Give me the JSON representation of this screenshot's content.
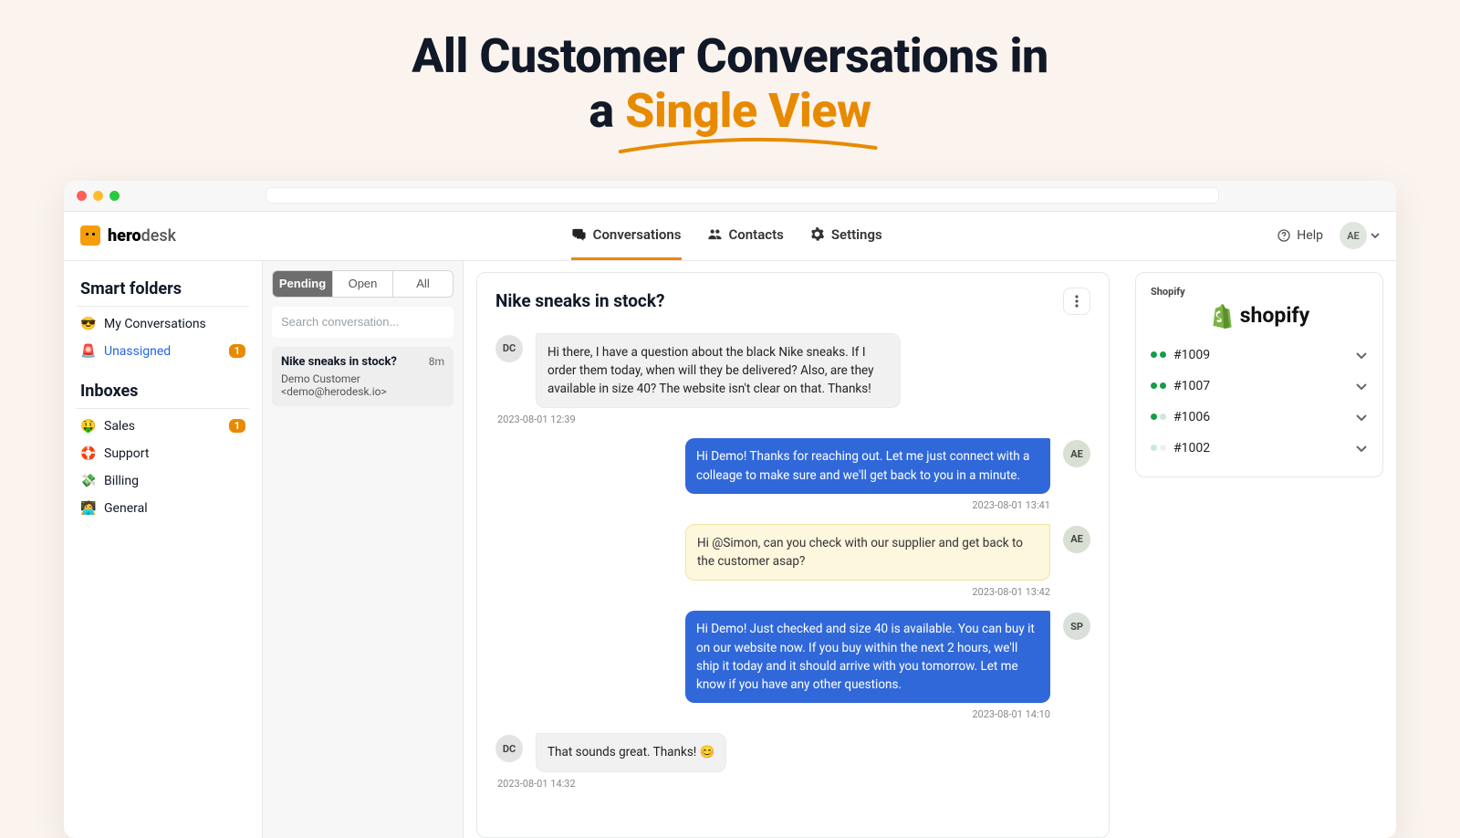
{
  "headline": {
    "pre": "All Customer Conversations in",
    "mid": "a ",
    "accent": "Single View"
  },
  "brand": {
    "name_bold": "hero",
    "name_rest": "desk"
  },
  "nav": {
    "conversations": "Conversations",
    "contacts": "Contacts",
    "settings": "Settings"
  },
  "tools": {
    "help": "Help",
    "user_initials": "AE"
  },
  "sidebar": {
    "smart_head": "Smart folders",
    "items": [
      {
        "emoji": "😎",
        "label": "My Conversations"
      },
      {
        "emoji": "🚨",
        "label": "Unassigned",
        "badge": "1",
        "link": true
      }
    ],
    "inboxes_head": "Inboxes",
    "inboxes": [
      {
        "emoji": "🤑",
        "label": "Sales",
        "badge": "1"
      },
      {
        "emoji": "🛟",
        "label": "Support"
      },
      {
        "emoji": "💸",
        "label": "Billing"
      },
      {
        "emoji": "🧑‍💻",
        "label": "General"
      }
    ]
  },
  "list": {
    "tabs": {
      "pending": "Pending",
      "open": "Open",
      "all": "All"
    },
    "search_placeholder": "Search conversation...",
    "conv": {
      "title": "Nike sneaks in stock?",
      "age": "8m",
      "from": "Demo Customer <demo@herodesk.io>"
    }
  },
  "thread": {
    "title": "Nike sneaks in stock?",
    "m1": {
      "av": "DC",
      "text": "Hi there, I have a question about the black Nike sneaks. If I order them today, when will they be delivered? Also, are they available in size 40? The website isn't clear on that. Thanks!",
      "ts": "2023-08-01 12:39"
    },
    "m2": {
      "av": "AE",
      "text": "Hi Demo! Thanks for reaching out. Let me just connect with a colleage to make sure and we'll get back to you in a minute.",
      "ts": "2023-08-01 13:41"
    },
    "m3": {
      "av": "AE",
      "text": "Hi @Simon, can you check with our supplier and get back to the customer asap?",
      "ts": "2023-08-01 13:42"
    },
    "m4": {
      "av": "SP",
      "text": "Hi Demo! Just checked and size 40 is available. You can buy it on our website now. If you buy within the next 2 hours, we'll ship it today and it should arrive with you tomorrow. Let me know if you have any other questions.",
      "ts": "2023-08-01 14:10"
    },
    "m5": {
      "av": "DC",
      "text": "That sounds great. Thanks! 😊",
      "ts": "2023-08-01 14:32"
    }
  },
  "rpanel": {
    "head": "Shopify",
    "brand": "shopify",
    "orders": [
      {
        "id": "#1009",
        "s1": "fill",
        "s2": "fill"
      },
      {
        "id": "#1007",
        "s1": "fill",
        "s2": "fill"
      },
      {
        "id": "#1006",
        "s1": "fill",
        "s2": "light"
      },
      {
        "id": "#1002",
        "s1": "light",
        "s2": "fade"
      }
    ]
  }
}
